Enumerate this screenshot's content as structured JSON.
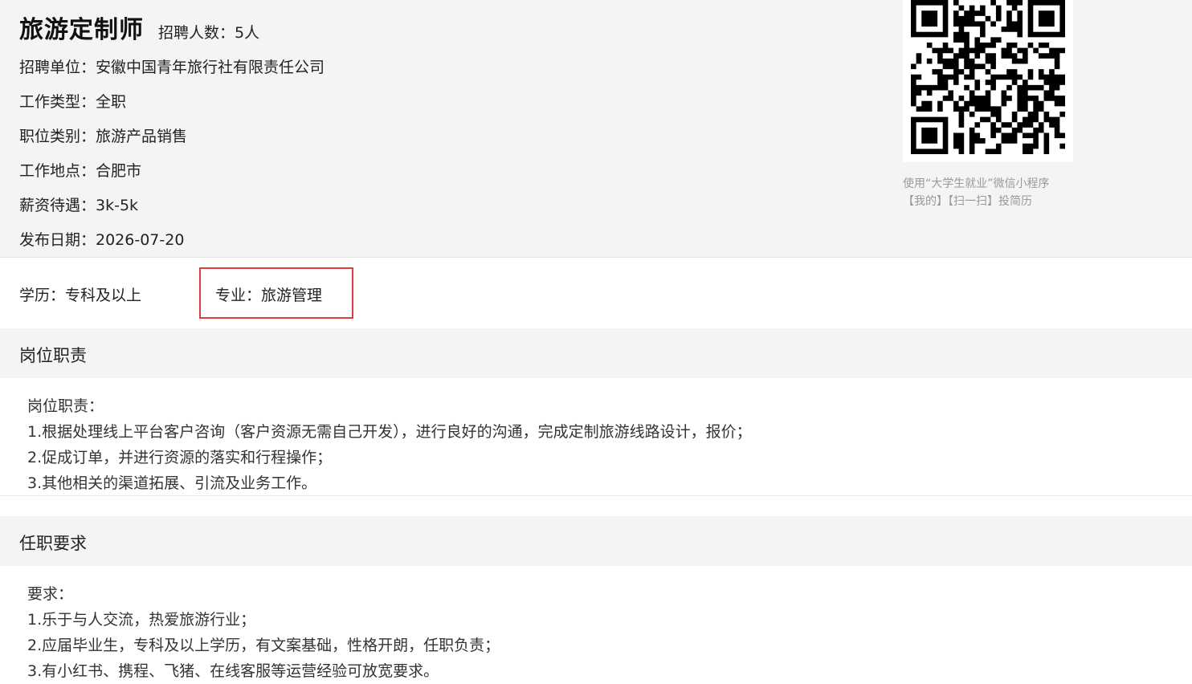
{
  "job": {
    "title": "旅游定制师",
    "count_text": "招聘人数：5人",
    "fields": [
      "招聘单位：安徽中国青年旅行社有限责任公司",
      "工作类型：全职",
      "职位类别：旅游产品销售",
      "工作地点：合肥市",
      "薪资待遇：3k-5k",
      "发布日期：2026-07-20"
    ]
  },
  "qr": {
    "note_line1": "使用“大学生就业”微信小程序",
    "note_line2": "【我的】【扫一扫】投简历"
  },
  "requirements": {
    "education": "学历：专科及以上",
    "major": "专业：旅游管理",
    "highlight_color": "#e0393e"
  },
  "duties": {
    "heading": "岗位职责",
    "lines": [
      "岗位职责：",
      "1.根据处理线上平台客户咨询（客户资源无需自己开发），进行良好的沟通，完成定制旅游线路设计，报价；",
      "2.促成订单，并进行资源的落实和行程操作；",
      "3.其他相关的渠道拓展、引流及业务工作。"
    ]
  },
  "qualifications": {
    "heading": "任职要求",
    "lines": [
      "要求：",
      "1.乐于与人交流，热爱旅游行业；",
      "2.应届毕业生，专科及以上学历，有文案基础，性格开朗，任职负责；",
      "3.有小红书、携程、飞猪、在线客服等运营经验可放宽要求。"
    ]
  }
}
